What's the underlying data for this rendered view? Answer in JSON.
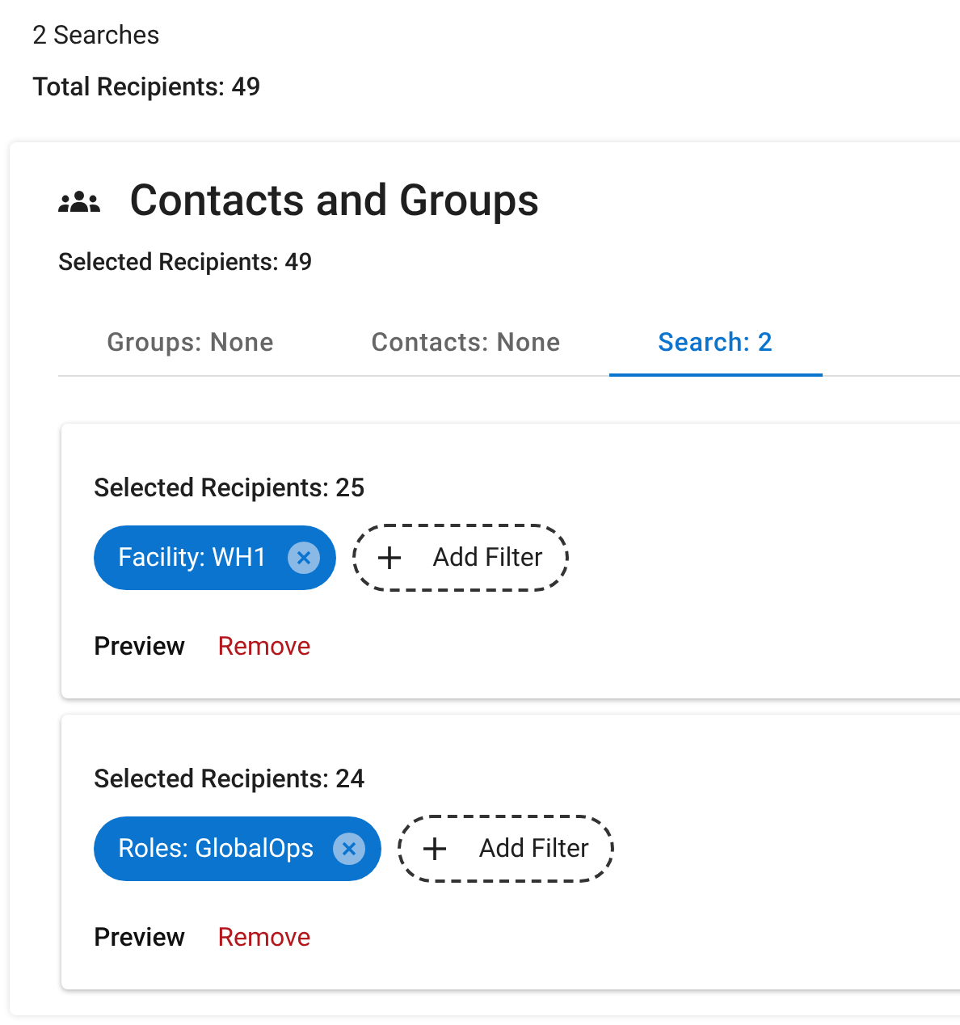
{
  "summary": {
    "searches": "2 Searches",
    "total": "Total Recipients: 49"
  },
  "panel": {
    "title": "Contacts and Groups",
    "selected_recipients": "Selected Recipients: 49"
  },
  "tabs": [
    {
      "label": "Groups: None",
      "selected": false
    },
    {
      "label": "Contacts: None",
      "selected": false
    },
    {
      "label": "Search: 2",
      "selected": true
    }
  ],
  "searches": [
    {
      "selected_recipients": "Selected Recipients: 25",
      "filters": [
        "Facility: WH1"
      ],
      "add_filter": "Add Filter",
      "preview": "Preview",
      "remove": "Remove"
    },
    {
      "selected_recipients": "Selected Recipients: 24",
      "filters": [
        "Roles: GlobalOps"
      ],
      "add_filter": "Add Filter",
      "preview": "Preview",
      "remove": "Remove"
    }
  ]
}
